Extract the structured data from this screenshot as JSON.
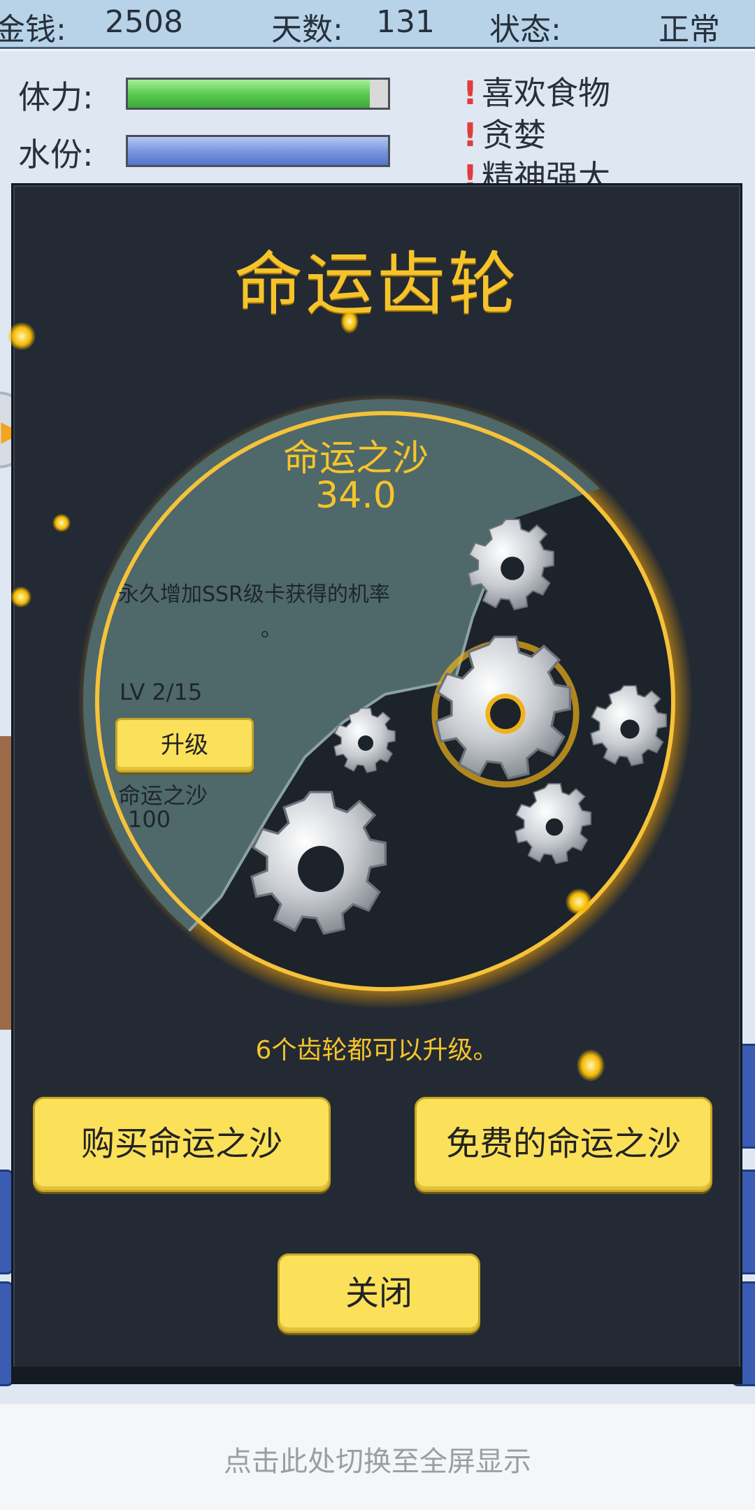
{
  "topbar": {
    "money_label": "金钱:",
    "money_value": "2508",
    "days_label": "天数:",
    "days_value": "131",
    "status_label": "状态:",
    "status_value": "正常"
  },
  "stats": {
    "stamina_label": "体力:",
    "stamina_level": 0.93,
    "water_label": "水份:",
    "water_level": 1.0
  },
  "traits": [
    "喜欢食物",
    "贪婪",
    "精神强大"
  ],
  "modal": {
    "title": "命运齿轮",
    "currency_name": "命运之沙",
    "currency_value": "34.0",
    "description": "永久增加SSR级卡获得的机率",
    "description_end": "。",
    "level_text": "LV 2/15",
    "upgrade_label": "升级",
    "cost_name": "命运之沙",
    "cost_value": "100",
    "hint": "6个齿轮都可以升级。",
    "buy_button": "购买命运之沙",
    "free_button": "免费的命运之沙",
    "close_button": "关闭"
  },
  "footer": {
    "fullscreen_text": "点击此处切换至全屏显示"
  },
  "colors": {
    "accent_gold": "#f6c42a",
    "button_yellow": "#fbe15a",
    "modal_bg": "#232a33",
    "panel_teal": "#4f6869"
  }
}
